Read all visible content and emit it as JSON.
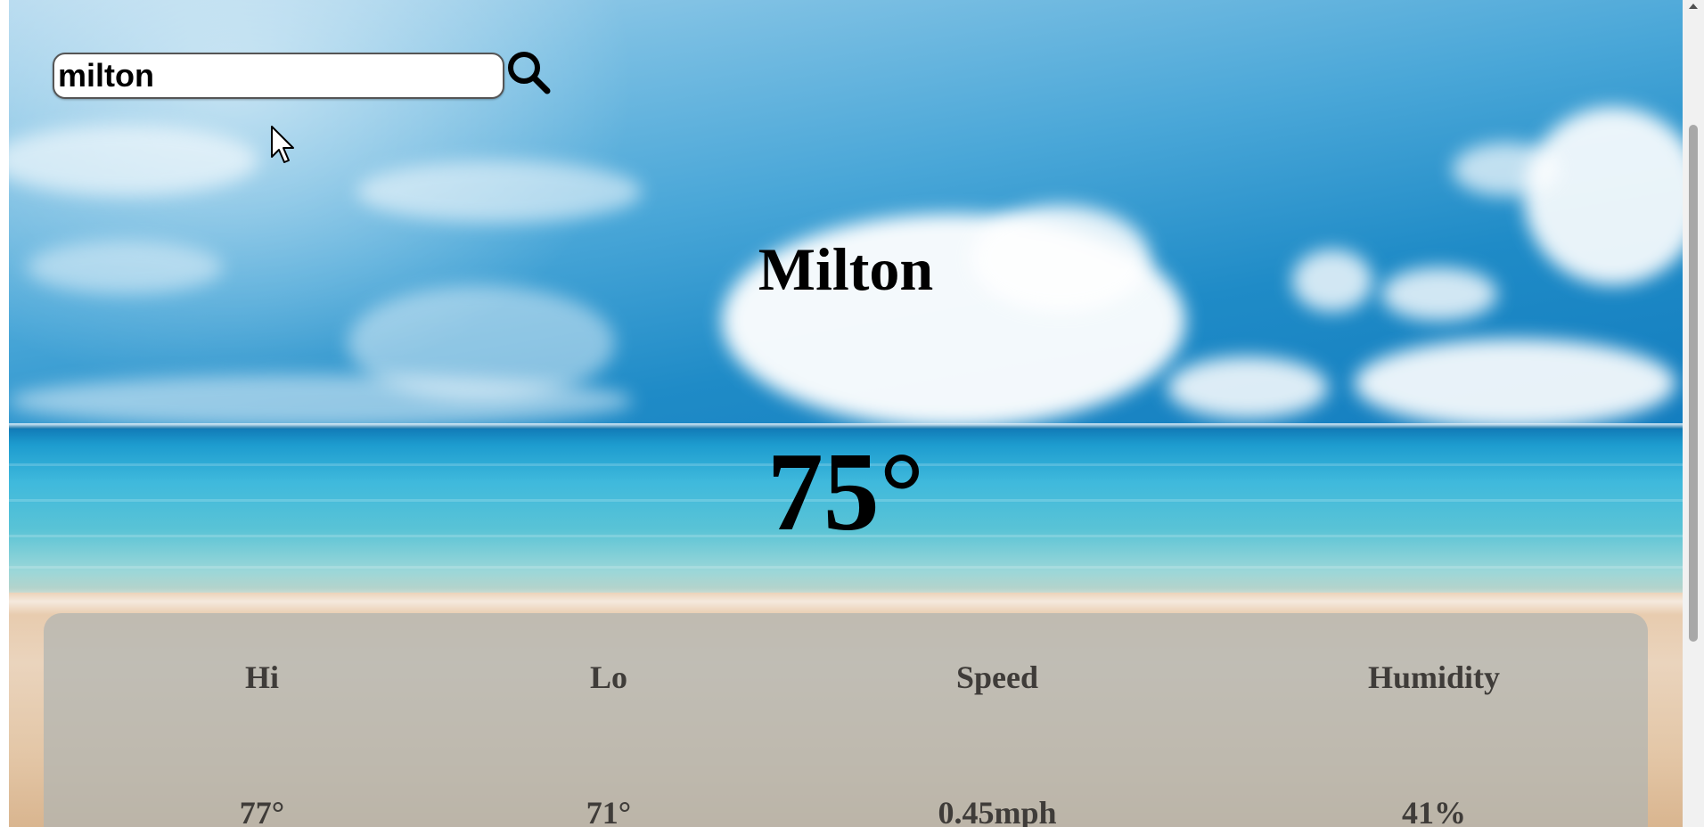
{
  "search": {
    "value": "milton",
    "icon": "search-icon"
  },
  "weather": {
    "city": "Milton",
    "temperature": "75°"
  },
  "stats": [
    {
      "label": "Hi",
      "value": "77°"
    },
    {
      "label": "Lo",
      "value": "71°"
    },
    {
      "label": "Speed",
      "value": "0.45mph"
    },
    {
      "label": "Humidity",
      "value": "41%"
    }
  ],
  "colors": {
    "panel": "#b0b4b2",
    "stat_text": "#3f3c39",
    "title_text": "#000000"
  }
}
